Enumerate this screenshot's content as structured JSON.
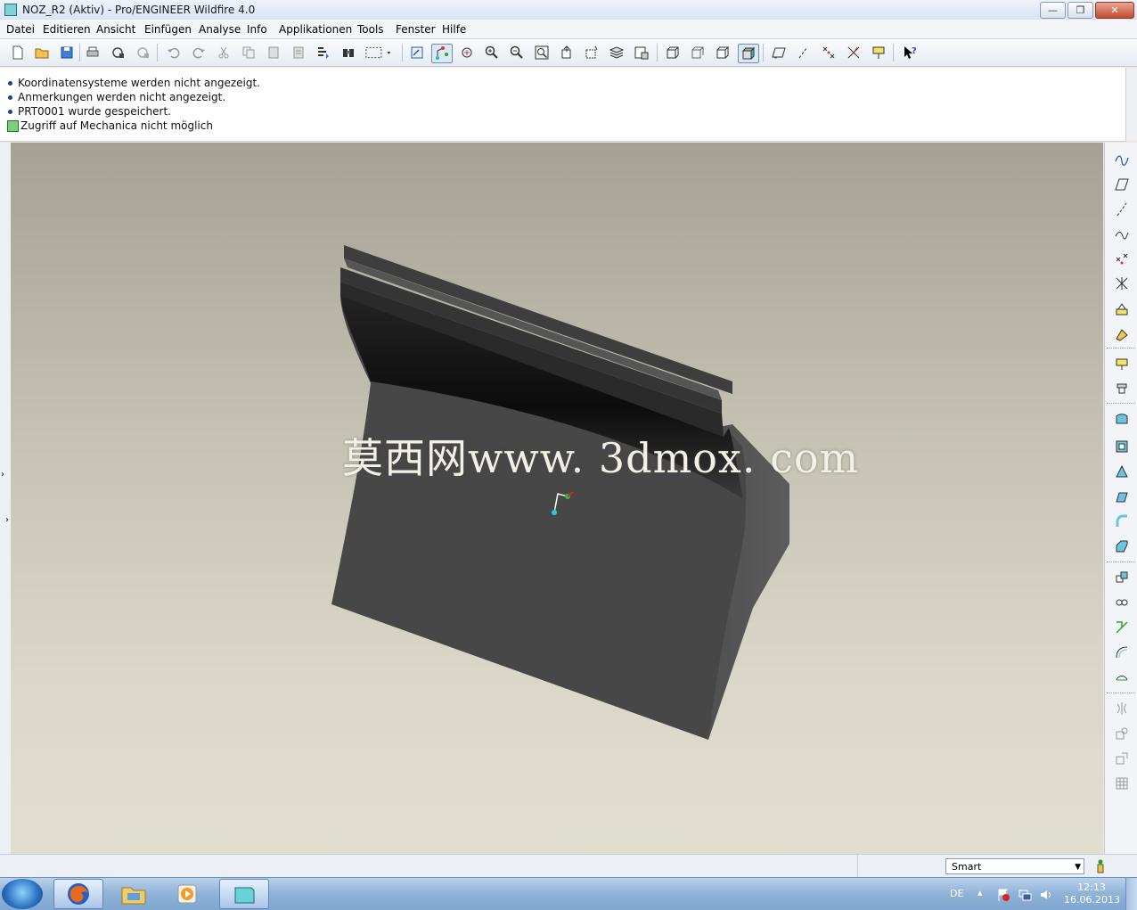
{
  "window": {
    "title": "NOZ_R2 (Aktiv) - Pro/ENGINEER Wildfire 4.0",
    "buttons": {
      "minimize": "—",
      "restore": "❐",
      "close": "✕"
    }
  },
  "menu": {
    "items": [
      "Datei",
      "Editieren",
      "Ansicht",
      "Einfügen",
      "Analyse",
      "Info",
      "Applikationen",
      "Tools",
      "Fenster",
      "Hilfe"
    ]
  },
  "toolbar": {
    "icons": [
      "new-file-icon",
      "open-folder-icon",
      "save-icon",
      "print-icon",
      "send-mail-icon",
      "mail-icon",
      "undo-icon",
      "redo-icon",
      "cut-icon",
      "copy-icon",
      "paste-icon",
      "paste-special-icon",
      "regenerate-icon",
      "find-icon",
      "selection-box-icon",
      "redraw-icon",
      "spin-center-icon",
      "orient-mode-icon",
      "zoom-in-icon",
      "zoom-out-icon",
      "refit-icon",
      "reorient-icon",
      "saved-views-icon",
      "layers-icon",
      "view-manager-icon",
      "wireframe-icon",
      "hidden-line-icon",
      "no-hidden-icon",
      "shading-icon",
      "datum-planes-icon",
      "datum-axes-icon",
      "datum-points-icon",
      "coordinate-systems-icon",
      "annotations-icon",
      "context-help-icon"
    ]
  },
  "messages": [
    {
      "type": "info",
      "text": "Koordinatensysteme werden nicht angezeigt."
    },
    {
      "type": "info",
      "text": "Anmerkungen werden nicht angezeigt."
    },
    {
      "type": "info",
      "text": "PRT0001 wurde gespeichert."
    },
    {
      "type": "warning",
      "text": "Zugriff auf Mechanica nicht möglich"
    }
  ],
  "viewport": {
    "watermark": "莫西网www. 3dmox. com",
    "model_color": "#474747",
    "background_top": "#a5a195",
    "background_bottom": "#e1ded0"
  },
  "right_toolbar": {
    "icons": [
      "sketch-tool-icon",
      "datum-plane-icon",
      "datum-axis-icon",
      "datum-curve-icon",
      "datum-point-icon",
      "coordinate-system-icon",
      "analysis-feature-icon",
      "insert-part-icon",
      "extrude-icon",
      "revolve-icon",
      "hole-icon",
      "shell-icon",
      "rib-icon",
      "draft-icon",
      "round-icon",
      "chamfer-icon",
      "group-icon",
      "copy-feature-icon",
      "pattern-icon",
      "mirror-icon",
      "merge-icon",
      "trim-icon",
      "offset-icon",
      "thicken-icon",
      "solidify-icon"
    ]
  },
  "status": {
    "filter_value": "Smart",
    "filter_options": [
      "Smart"
    ]
  },
  "taskbar": {
    "language": "DE",
    "time": "12:13",
    "date": "16.06.2013",
    "apps": [
      "firefox-icon",
      "explorer-folder-icon",
      "media-player-icon",
      "proe-icon"
    ]
  }
}
